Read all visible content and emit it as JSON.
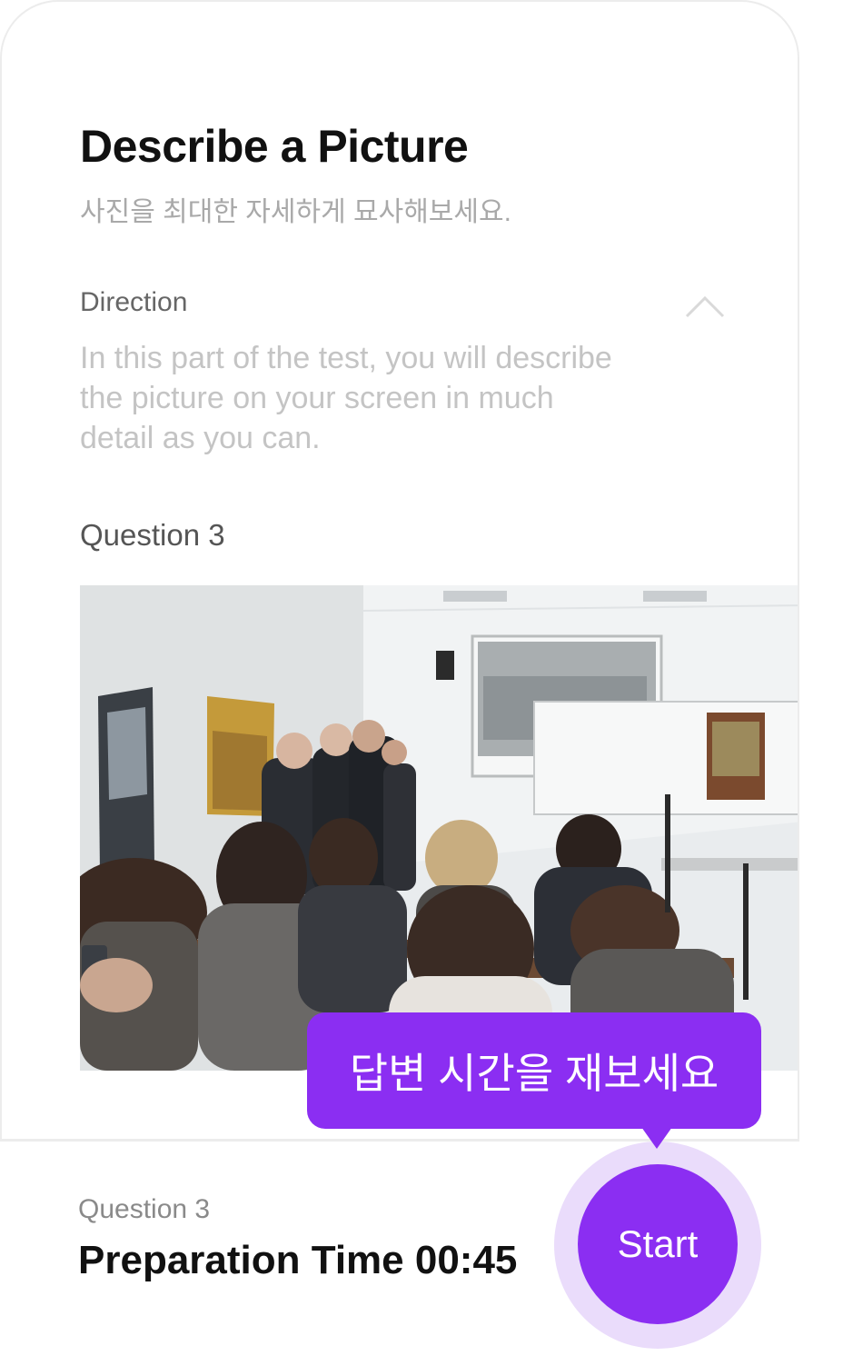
{
  "header": {
    "title": "Describe a Picture",
    "subtitle": "사진을 최대한 자세하게 묘사해보세요."
  },
  "direction": {
    "label": "Direction",
    "toggle_icon": "chevron-up-icon",
    "body": "In this part of the test, you will describe the picture on your screen in much detail as you can."
  },
  "question": {
    "label": "Question 3",
    "image_alt": "photo"
  },
  "footer": {
    "question_label": "Question 3",
    "preparation_time": "Preparation Time 00:45",
    "start_label": "Start",
    "tooltip": "답변 시간을 재보세요"
  },
  "colors": {
    "accent": "#8b2ef2",
    "accent_halo": "#eadcfb",
    "title": "#111111",
    "muted": "#a9a9a9"
  }
}
